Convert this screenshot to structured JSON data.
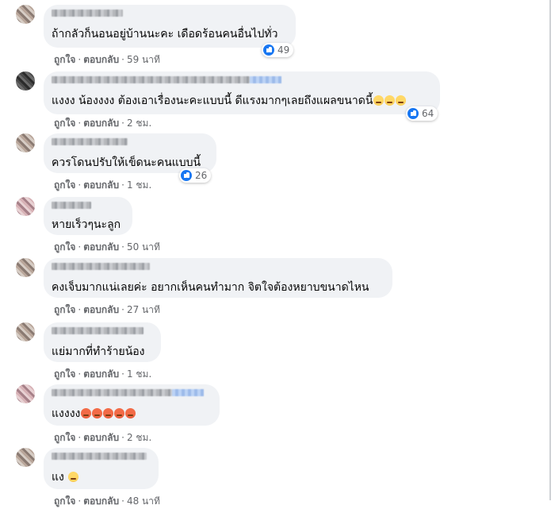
{
  "comments": [
    {
      "text": "ถ้ากลัวก็นอนอยู่บ้านนะคะ เดือดร้อนคนอื่นไปทั่ว",
      "emojis": [],
      "reaction_count": "49",
      "like_label": "ถูกใจ",
      "reply_label": "ตอบกลับ",
      "time": "59 นาที"
    },
    {
      "text": "แงงง น้องงงง ต้องเอาเรื่องนะคะแบบนี้ ดีแรงมากๆเลยถึงแผลขนาดนี้",
      "emojis": [
        "crying-face",
        "crying-face",
        "crying-face"
      ],
      "reaction_count": "64",
      "like_label": "ถูกใจ",
      "reply_label": "ตอบกลับ",
      "time": "2 ชม."
    },
    {
      "text": "ควรโดนปรับให้เข็ดนะคนแบบนี้",
      "emojis": [],
      "reaction_count": "26",
      "like_label": "ถูกใจ",
      "reply_label": "ตอบกลับ",
      "time": "1 ชม."
    },
    {
      "text": "หายเร็วๆนะลูก",
      "emojis": [],
      "reaction_count": "",
      "like_label": "ถูกใจ",
      "reply_label": "ตอบกลับ",
      "time": "50 นาที"
    },
    {
      "text": "คงเจ็บมากแน่เลยค่ะ อยากเห็นคนทำมาก จิตใจต้องหยาบขนาดไหน",
      "emojis": [],
      "reaction_count": "",
      "like_label": "ถูกใจ",
      "reply_label": "ตอบกลับ",
      "time": "27 นาที"
    },
    {
      "text": "แย่มากที่ทำร้ายน้อง",
      "emojis": [],
      "reaction_count": "",
      "like_label": "ถูกใจ",
      "reply_label": "ตอบกลับ",
      "time": "1 ชม."
    },
    {
      "text": "แงงงง",
      "emojis": [
        "angry-face",
        "angry-face",
        "angry-face",
        "angry-face",
        "angry-face"
      ],
      "reaction_count": "",
      "like_label": "ถูกใจ",
      "reply_label": "ตอบกลับ",
      "time": "2 ชม."
    },
    {
      "text": "แง",
      "emojis": [
        "crying-face"
      ],
      "reaction_count": "",
      "like_label": "ถูกใจ",
      "reply_label": "ตอบกลับ",
      "time": "48 นาที"
    }
  ],
  "separator": "·",
  "colors": {
    "bubble": "#f0f2f5",
    "text": "#050505",
    "meta": "#65676b",
    "like": "#1877f2"
  }
}
